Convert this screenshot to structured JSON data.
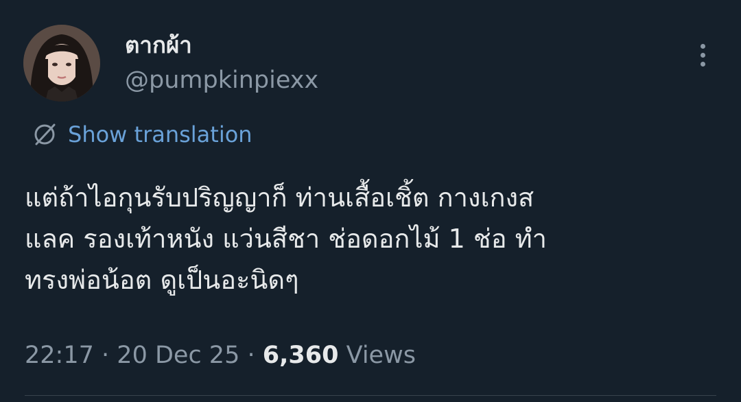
{
  "author": {
    "display_name": "ตากผ้า",
    "handle": "@pumpkinpiexx",
    "avatar_icon": "profile-photo"
  },
  "actions": {
    "more_icon": "more-options-icon"
  },
  "translation": {
    "icon": "translate-icon",
    "label": "Show translation"
  },
  "tweet": {
    "text": "แต่ถ้าไอกุนรับปริญญาก็ ท่านเสื้อเชิ้ต กางเกงส\nแลค รองเท้าหนัง แว่นสีชา ช่อดอกไม้ 1 ช่อ ทำ\nทรงพ่อน้อต ดูเป็นอะนิดๆ"
  },
  "meta": {
    "time": "22:17",
    "separator": "·",
    "date": "20 Dec 25",
    "views_count": "6,360",
    "views_label": "Views"
  },
  "colors": {
    "background": "#15202b",
    "text_primary": "#e7e9ea",
    "text_secondary": "#8b98a5",
    "link": "#6aa2d9"
  }
}
